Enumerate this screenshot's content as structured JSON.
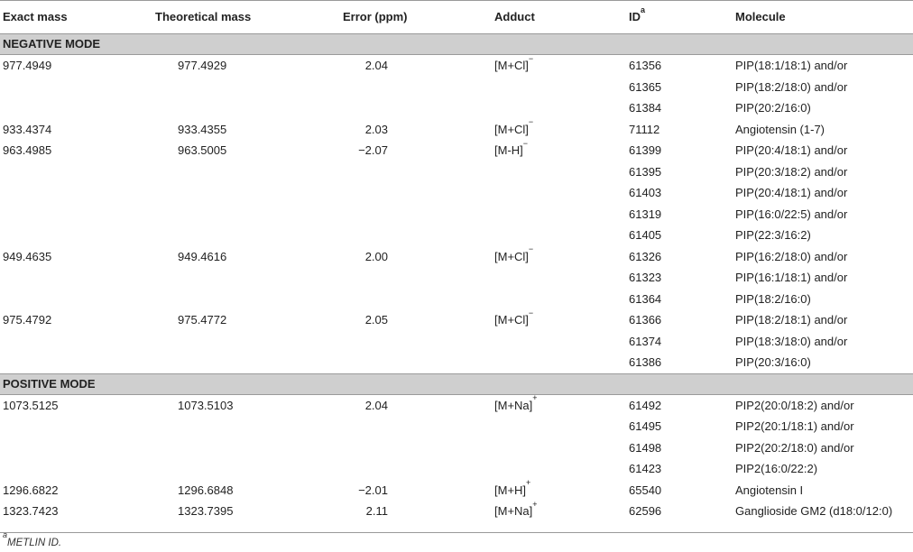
{
  "header": {
    "exact_mass": "Exact mass",
    "theoretical_mass": "Theoretical mass",
    "error": "Error (ppm)",
    "adduct": "Adduct",
    "id": "ID",
    "id_sup": "a",
    "molecule": "Molecule"
  },
  "sections": [
    {
      "title": "NEGATIVE MODE",
      "rows": [
        {
          "exact": "977.4949",
          "theoretical": "977.4929",
          "error": "2.04",
          "adduct_base": "[M+Cl]",
          "adduct_charge": "−",
          "id": "61356",
          "molecule": "PIP(18:1/18:1) and/or"
        },
        {
          "exact": "",
          "theoretical": "",
          "error": "",
          "adduct_base": "",
          "adduct_charge": "",
          "id": "61365",
          "molecule": "PIP(18:2/18:0) and/or"
        },
        {
          "exact": "",
          "theoretical": "",
          "error": "",
          "adduct_base": "",
          "adduct_charge": "",
          "id": "61384",
          "molecule": "PIP(20:2/16:0)"
        },
        {
          "exact": "933.4374",
          "theoretical": "933.4355",
          "error": "2.03",
          "adduct_base": "[M+Cl]",
          "adduct_charge": "−",
          "id": "71112",
          "molecule": "Angiotensin (1-7)"
        },
        {
          "exact": "963.4985",
          "theoretical": "963.5005",
          "error": "−2.07",
          "adduct_base": "[M-H]",
          "adduct_charge": "−",
          "id": "61399",
          "molecule": "PIP(20:4/18:1) and/or"
        },
        {
          "exact": "",
          "theoretical": "",
          "error": "",
          "adduct_base": "",
          "adduct_charge": "",
          "id": "61395",
          "molecule": "PIP(20:3/18:2) and/or"
        },
        {
          "exact": "",
          "theoretical": "",
          "error": "",
          "adduct_base": "",
          "adduct_charge": "",
          "id": "61403",
          "molecule": "PIP(20:4/18:1) and/or"
        },
        {
          "exact": "",
          "theoretical": "",
          "error": "",
          "adduct_base": "",
          "adduct_charge": "",
          "id": "61319",
          "molecule": "PIP(16:0/22:5) and/or"
        },
        {
          "exact": "",
          "theoretical": "",
          "error": "",
          "adduct_base": "",
          "adduct_charge": "",
          "id": "61405",
          "molecule": "PIP(22:3/16:2)"
        },
        {
          "exact": "949.4635",
          "theoretical": "949.4616",
          "error": "2.00",
          "adduct_base": "[M+Cl]",
          "adduct_charge": "−",
          "id": "61326",
          "molecule": "PIP(16:2/18:0) and/or"
        },
        {
          "exact": "",
          "theoretical": "",
          "error": "",
          "adduct_base": "",
          "adduct_charge": "",
          "id": "61323",
          "molecule": "PIP(16:1/18:1) and/or"
        },
        {
          "exact": "",
          "theoretical": "",
          "error": "",
          "adduct_base": "",
          "adduct_charge": "",
          "id": "61364",
          "molecule": "PIP(18:2/16:0)"
        },
        {
          "exact": "975.4792",
          "theoretical": "975.4772",
          "error": "2.05",
          "adduct_base": "[M+Cl]",
          "adduct_charge": "−",
          "id": "61366",
          "molecule": "PIP(18:2/18:1) and/or"
        },
        {
          "exact": "",
          "theoretical": "",
          "error": "",
          "adduct_base": "",
          "adduct_charge": "",
          "id": "61374",
          "molecule": "PIP(18:3/18:0) and/or"
        },
        {
          "exact": "",
          "theoretical": "",
          "error": "",
          "adduct_base": "",
          "adduct_charge": "",
          "id": "61386",
          "molecule": "PIP(20:3/16:0)"
        }
      ]
    },
    {
      "title": "POSITIVE MODE",
      "rows": [
        {
          "exact": "1073.5125",
          "theoretical": "1073.5103",
          "error": "2.04",
          "adduct_base": "[M+Na]",
          "adduct_charge": "+",
          "id": "61492",
          "molecule": "PIP2(20:0/18:2) and/or"
        },
        {
          "exact": "",
          "theoretical": "",
          "error": "",
          "adduct_base": "",
          "adduct_charge": "",
          "id": "61495",
          "molecule": "PIP2(20:1/18:1) and/or"
        },
        {
          "exact": "",
          "theoretical": "",
          "error": "",
          "adduct_base": "",
          "adduct_charge": "",
          "id": "61498",
          "molecule": "PIP2(20:2/18:0) and/or"
        },
        {
          "exact": "",
          "theoretical": "",
          "error": "",
          "adduct_base": "",
          "adduct_charge": "",
          "id": "61423",
          "molecule": "PIP2(16:0/22:2)"
        },
        {
          "exact": "1296.6822",
          "theoretical": "1296.6848",
          "error": "−2.01",
          "adduct_base": "[M+H]",
          "adduct_charge": "+",
          "id": "65540",
          "molecule": "Angiotensin I"
        },
        {
          "exact": "1323.7423",
          "theoretical": "1323.7395",
          "error": "2.11",
          "adduct_base": "[M+Na]",
          "adduct_charge": "+",
          "id": "62596",
          "molecule": "Ganglioside GM2 (d18:0/12:0)"
        }
      ]
    }
  ],
  "footnote": {
    "sup": "a",
    "text": "METLIN ID."
  }
}
